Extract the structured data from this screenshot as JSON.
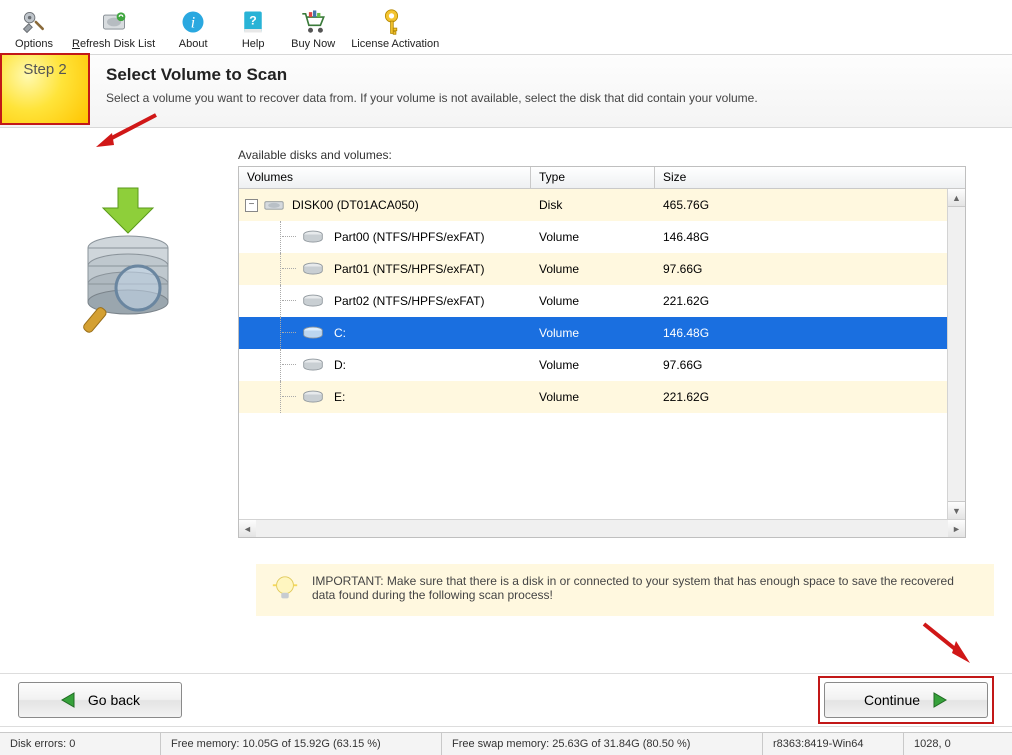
{
  "toolbar": {
    "options": "Options",
    "refresh_html": "<span class='u'>R</span>efresh Disk List",
    "about": "About",
    "help": "Help",
    "buy": "Buy Now",
    "license": "License Activation"
  },
  "step": {
    "label": "Step 2"
  },
  "header": {
    "title": "Select Volume to Scan",
    "subtitle": "Select a volume you want to recover data from. If your volume is not available, select the disk that did contain your volume."
  },
  "available_label": "Available disks and volumes:",
  "columns": {
    "volumes": "Volumes",
    "type": "Type",
    "size": "Size"
  },
  "rows": [
    {
      "name": "DISK00 (DT01ACA050)",
      "type": "Disk",
      "size": "465.76G",
      "kind": "disk",
      "alt": true,
      "sel": false
    },
    {
      "name": "Part00 (NTFS/HPFS/exFAT)",
      "type": "Volume",
      "size": "146.48G",
      "kind": "part",
      "alt": false,
      "sel": false
    },
    {
      "name": "Part01 (NTFS/HPFS/exFAT)",
      "type": "Volume",
      "size": "97.66G",
      "kind": "part",
      "alt": true,
      "sel": false
    },
    {
      "name": "Part02 (NTFS/HPFS/exFAT)",
      "type": "Volume",
      "size": "221.62G",
      "kind": "part",
      "alt": false,
      "sel": false
    },
    {
      "name": "C:",
      "type": "Volume",
      "size": "146.48G",
      "kind": "part",
      "alt": true,
      "sel": true
    },
    {
      "name": "D:",
      "type": "Volume",
      "size": "97.66G",
      "kind": "part",
      "alt": false,
      "sel": false
    },
    {
      "name": "E:",
      "type": "Volume",
      "size": "221.62G",
      "kind": "part",
      "alt": true,
      "sel": false
    }
  ],
  "note": "IMPORTANT: Make sure that there is a disk in or connected to your system that has enough space to save the recovered data found during the following scan process!",
  "buttons": {
    "goback": "Go back",
    "continue": "Continue"
  },
  "status": {
    "disk_errors": "Disk errors: 0",
    "free_mem": "Free memory: 10.05G of 15.92G (63.15 %)",
    "free_swap": "Free swap memory: 25.63G of 31.84G (80.50 %)",
    "build": "r8363:8419-Win64",
    "coords": "1028, 0"
  }
}
